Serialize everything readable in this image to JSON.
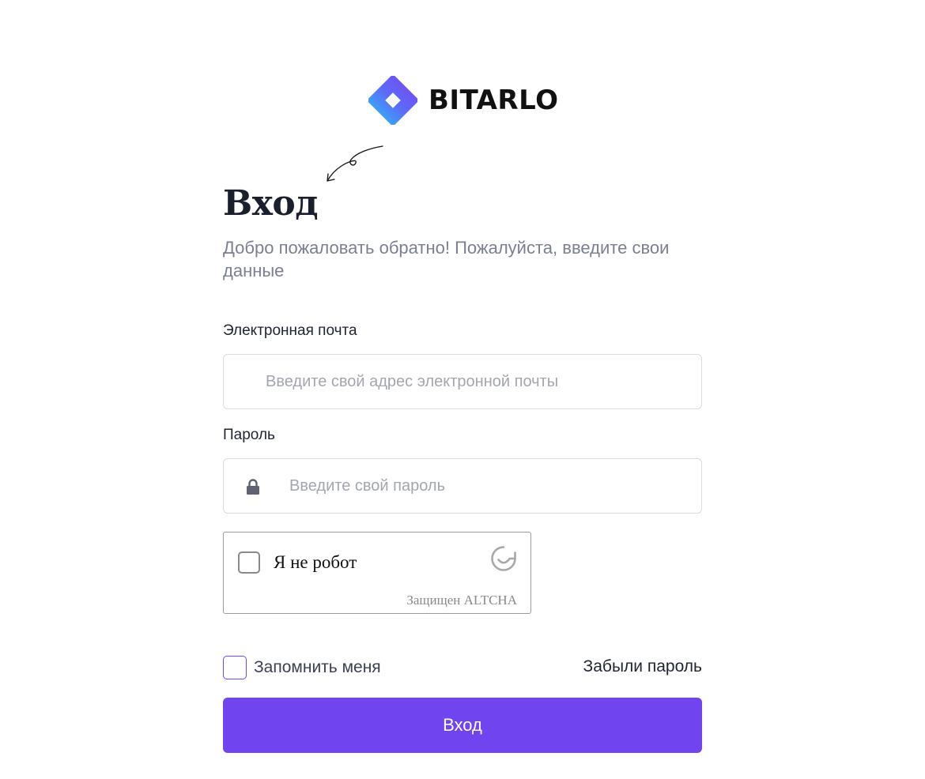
{
  "brand": {
    "name": "BITARLO",
    "logo_colors": [
      "#27c6f5",
      "#5b6cf8",
      "#7a43ef"
    ]
  },
  "login": {
    "title": "Вход",
    "subtitle": "Добро пожаловать обратно! Пожалуйста, введите свои данные",
    "email": {
      "label": "Электронная почта",
      "placeholder": "Введите свой адрес электронной почты",
      "value": ""
    },
    "password": {
      "label": "Пароль",
      "placeholder": "Введите свой пароль",
      "value": "",
      "icon": "lock-icon"
    },
    "captcha": {
      "label": "Я не робот",
      "footer": "Защищен ALTCHA",
      "checked": false,
      "icon": "altcha-logo-icon"
    },
    "remember": {
      "label": "Запомнить меня",
      "checked": false
    },
    "forgot_label": "Забыли пароль",
    "submit_label": "Вход"
  },
  "colors": {
    "accent": "#7045ef",
    "title": "#1a1f2e",
    "muted": "#7b7f93",
    "border": "#d9dbe1"
  }
}
